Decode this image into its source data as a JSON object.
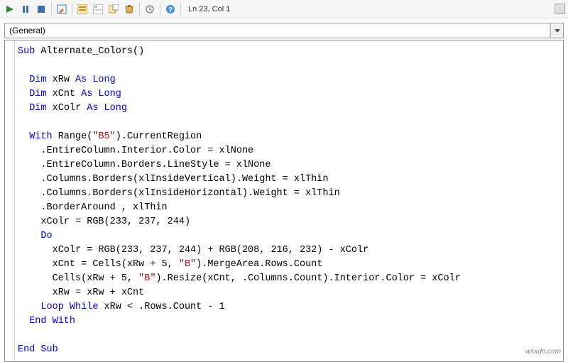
{
  "toolbar": {
    "status": "Ln 23, Col 1"
  },
  "dropdown": {
    "selected": "(General)"
  },
  "code": {
    "tokens": [
      [
        [
          "kw",
          "Sub"
        ],
        [
          "",
          " Alternate_Colors()"
        ]
      ],
      [
        [
          "",
          ""
        ]
      ],
      [
        [
          "",
          "  "
        ],
        [
          "kw",
          "Dim"
        ],
        [
          "",
          " xRw "
        ],
        [
          "kw",
          "As Long"
        ]
      ],
      [
        [
          "",
          "  "
        ],
        [
          "kw",
          "Dim"
        ],
        [
          "",
          " xCnt "
        ],
        [
          "kw",
          "As Long"
        ]
      ],
      [
        [
          "",
          "  "
        ],
        [
          "kw",
          "Dim"
        ],
        [
          "",
          " xColr "
        ],
        [
          "kw",
          "As Long"
        ]
      ],
      [
        [
          "",
          ""
        ]
      ],
      [
        [
          "",
          "  "
        ],
        [
          "kw",
          "With"
        ],
        [
          "",
          " Range("
        ],
        [
          "str",
          "\"B5\""
        ],
        [
          "",
          ").CurrentRegion"
        ]
      ],
      [
        [
          "",
          "    .EntireColumn.Interior.Color = xlNone"
        ]
      ],
      [
        [
          "",
          "    .EntireColumn.Borders.LineStyle = xlNone"
        ]
      ],
      [
        [
          "",
          "    .Columns.Borders(xlInsideVertical).Weight = xlThin"
        ]
      ],
      [
        [
          "",
          "    .Columns.Borders(xlInsideHorizontal).Weight = xlThin"
        ]
      ],
      [
        [
          "",
          "    .BorderAround , xlThin"
        ]
      ],
      [
        [
          "",
          "    xColr = RGB(233, 237, 244)"
        ]
      ],
      [
        [
          "",
          "    "
        ],
        [
          "kw",
          "Do"
        ]
      ],
      [
        [
          "",
          "      xColr = RGB(233, 237, 244) + RGB(208, 216, 232) - xColr"
        ]
      ],
      [
        [
          "",
          "      xCnt = Cells(xRw + 5, "
        ],
        [
          "str",
          "\"B\""
        ],
        [
          "",
          ").MergeArea.Rows.Count"
        ]
      ],
      [
        [
          "",
          "      Cells(xRw + 5, "
        ],
        [
          "str",
          "\"B\""
        ],
        [
          "",
          ").Resize(xCnt, .Columns.Count).Interior.Color = xColr"
        ]
      ],
      [
        [
          "",
          "      xRw = xRw + xCnt"
        ]
      ],
      [
        [
          "",
          "    "
        ],
        [
          "kw",
          "Loop While"
        ],
        [
          "",
          " xRw < .Rows.Count - 1"
        ]
      ],
      [
        [
          "",
          "  "
        ],
        [
          "kw",
          "End With"
        ]
      ],
      [
        [
          "",
          ""
        ]
      ],
      [
        [
          "kw",
          "End Sub"
        ]
      ]
    ]
  },
  "watermark": "wsxdn.com"
}
